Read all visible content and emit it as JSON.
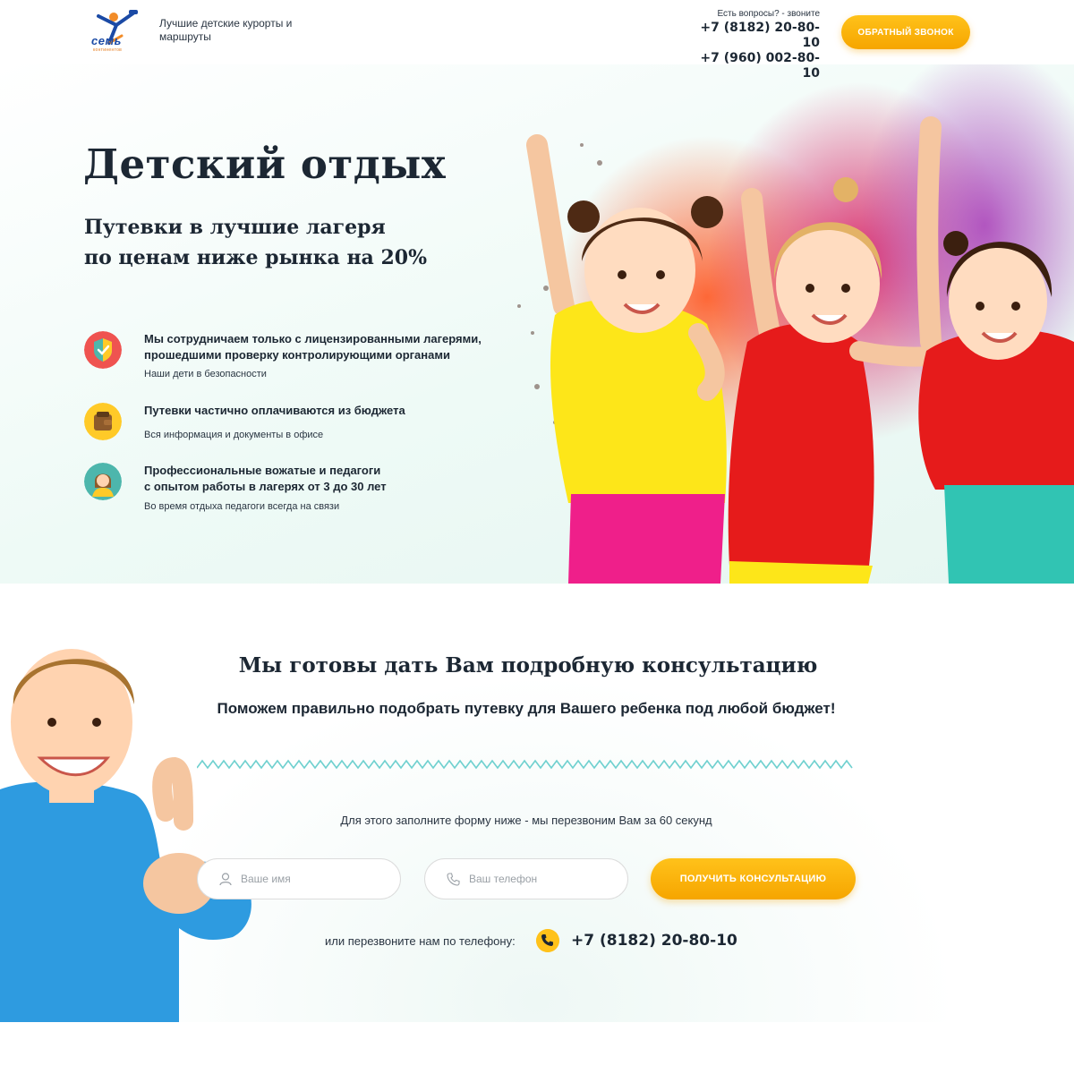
{
  "header": {
    "logo_text": "семь",
    "logo_sub": "континентов",
    "tagline": "Лучшие детские курорты и маршруты",
    "contacts_question": "Есть вопросы? - звоните",
    "phone_1": "+7 (8182) 20-80-10",
    "phone_2": "+7 (960) 002-80-10",
    "callback_button": "ОБРАТНЫЙ ЗВОНОК"
  },
  "hero": {
    "title": "Детский отдых",
    "subtitle_line1": "Путевки в лучшие лагеря",
    "subtitle_line2": "по ценам ниже рынка на 20%",
    "features": [
      {
        "icon": "shield-icon",
        "title_line1": "Мы сотрудничаем только с лицензированными лагерями,",
        "title_line2": "прошедшими проверку контролирующими органами",
        "description": "Наши дети в безопасности"
      },
      {
        "icon": "wallet-icon",
        "title_line1": "Путевки частично оплачиваются из бюджета",
        "title_line2": "",
        "description": "Вся информация и документы в офисе"
      },
      {
        "icon": "teacher-icon",
        "title_line1": "Профессиональные вожатые и педагоги",
        "title_line2": "с опытом работы в лагерях от 3 до 30 лет",
        "description": "Во время отдыха педагоги всегда на связи"
      }
    ]
  },
  "consult": {
    "title": "Мы готовы дать Вам подробную консультацию",
    "subtitle": "Поможем правильно подобрать путевку для Вашего ребенка под любой бюджет!",
    "note": "Для этого заполните форму ниже - мы перезвоним Вам за 60 секунд",
    "name_placeholder": "Ваше имя",
    "phone_placeholder": "Ваш телефон",
    "submit_button": "ПОЛУЧИТЬ КОНСУЛЬТАЦИЮ",
    "or_call": "или перезвоните нам по телефону:",
    "phone": "+7 (8182) 20-80-10"
  },
  "colors": {
    "accent": "#f6a500",
    "text": "#1c2733",
    "hero_bg": "#e6f6f1"
  }
}
